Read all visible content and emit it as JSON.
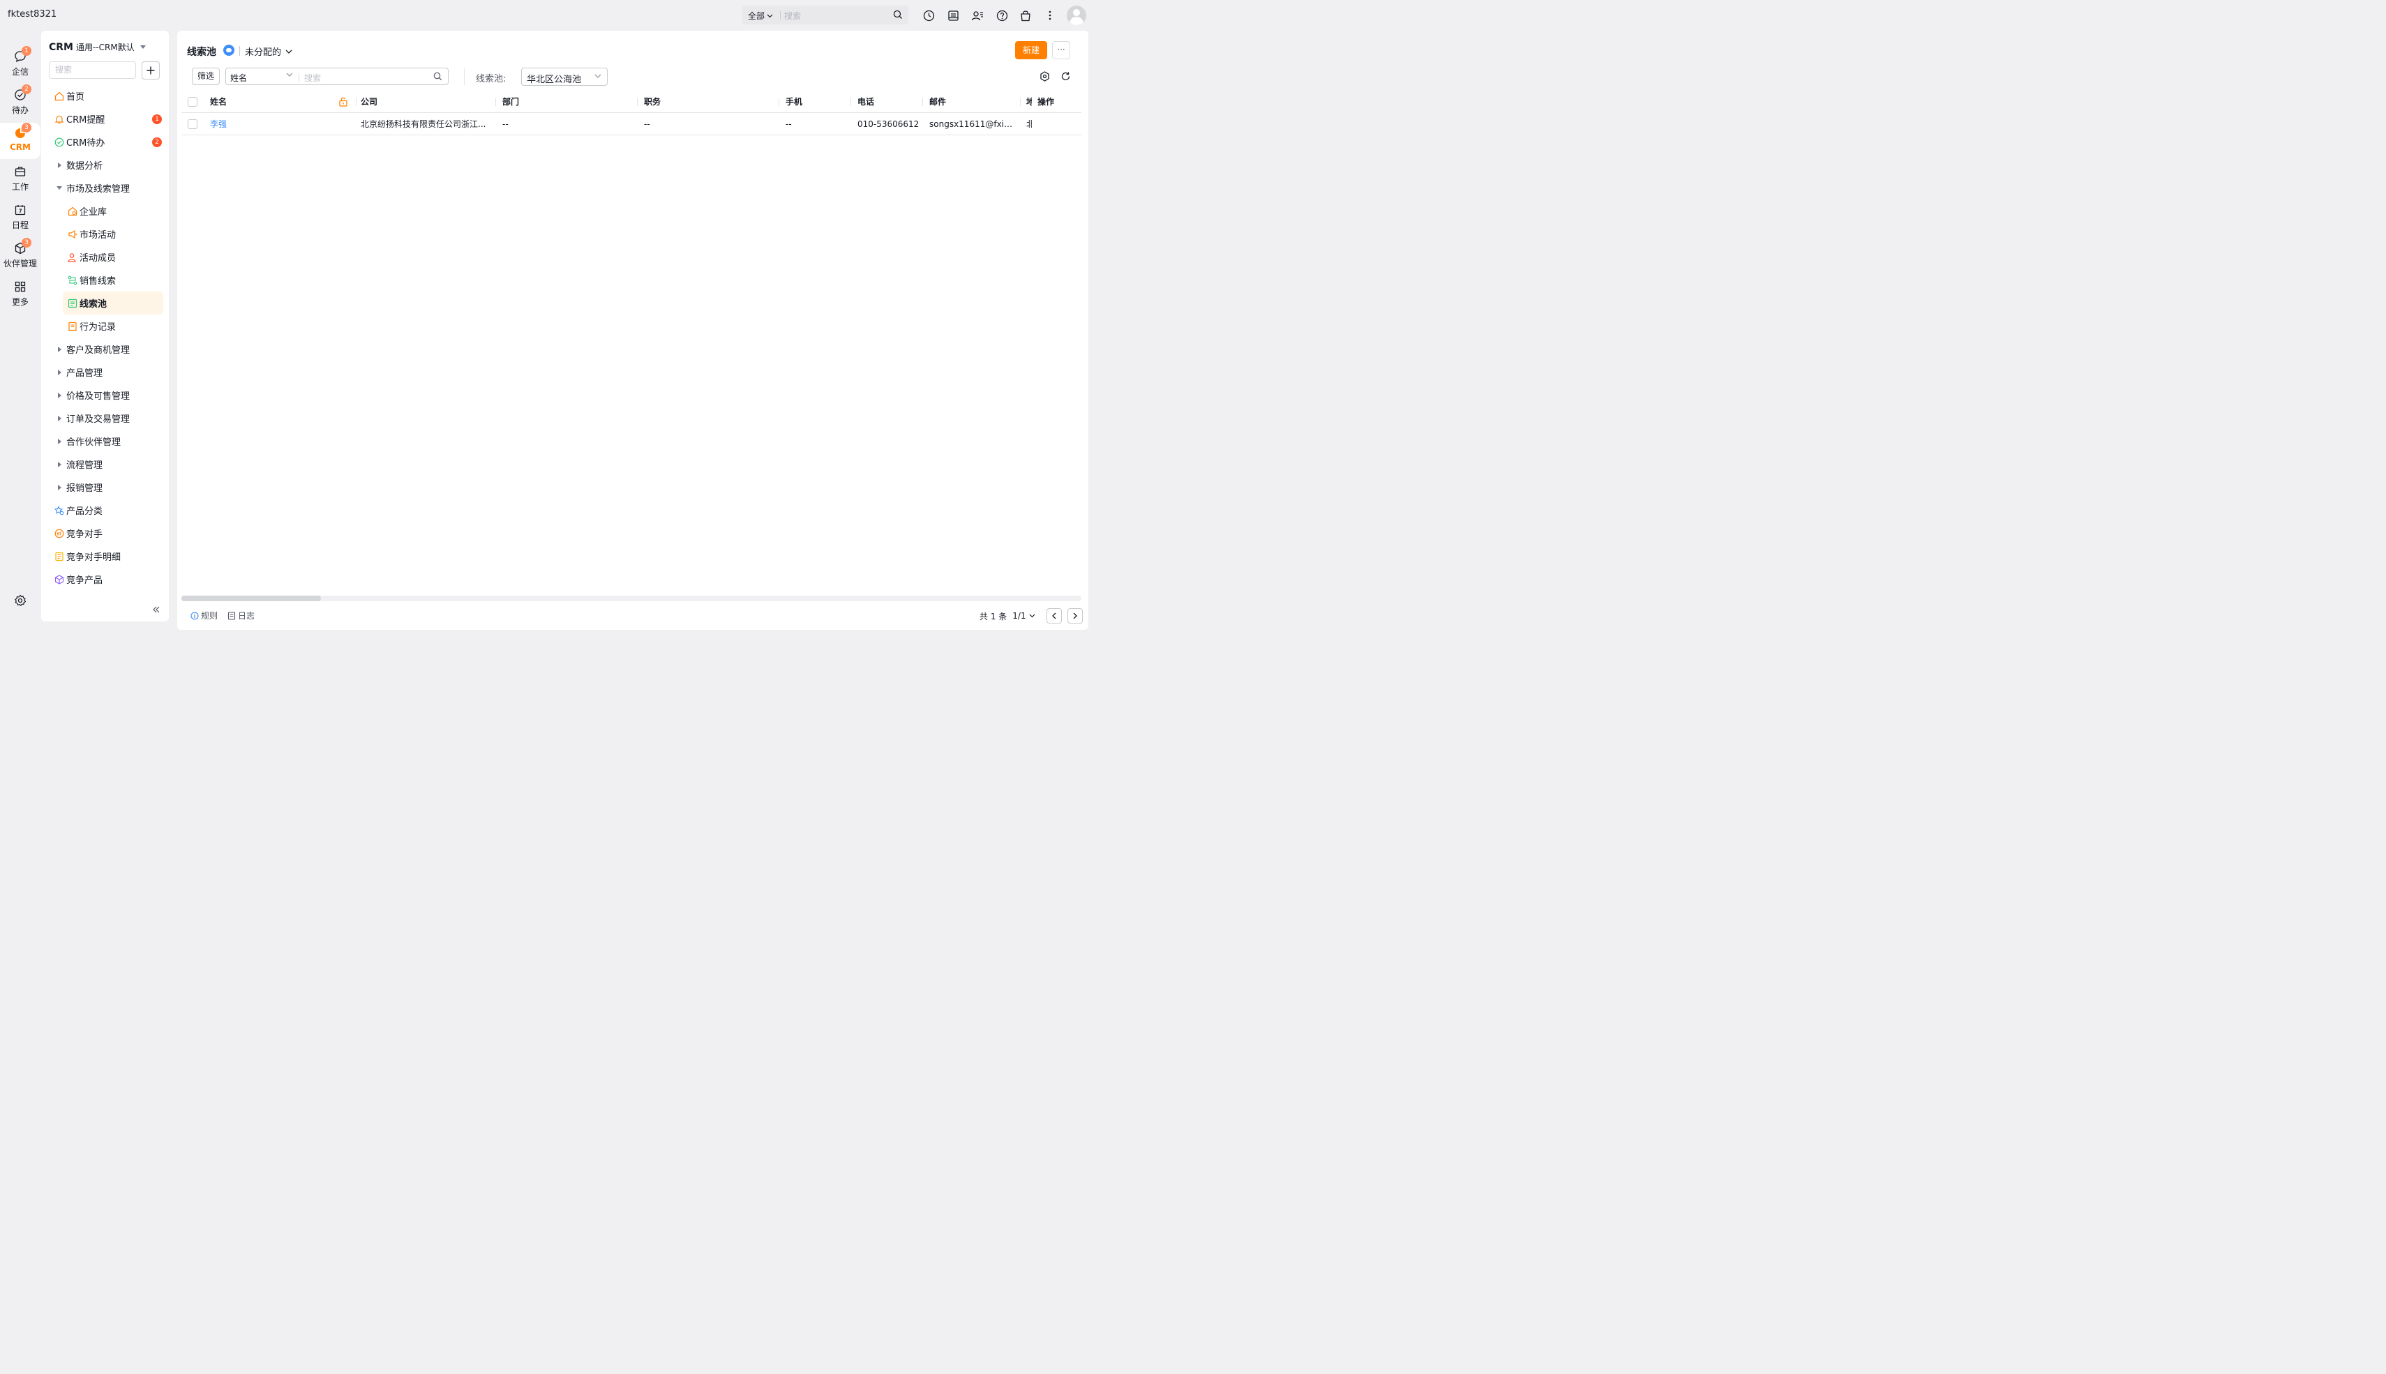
{
  "topbar": {
    "account": "fktest8321",
    "search_scope": "全部",
    "search_placeholder": "搜索",
    "icons": [
      "clock-icon",
      "inbox-icon",
      "contacts-icon",
      "help-icon",
      "bag-icon",
      "more-vertical-icon",
      "user-avatar"
    ]
  },
  "rail": {
    "items": [
      {
        "label": "企信",
        "badge": "1",
        "icon": "chat-bubble-icon"
      },
      {
        "label": "待办",
        "badge": "2",
        "icon": "todo-check-icon"
      },
      {
        "label": "CRM",
        "badge": "3",
        "icon": "crm-pie-icon",
        "active": true
      },
      {
        "label": "工作",
        "badge": "",
        "icon": "briefcase-icon"
      },
      {
        "label": "日程",
        "badge": "",
        "icon": "calendar-icon"
      },
      {
        "label": "伙伴管理",
        "badge": "3",
        "icon": "partner-cube-icon"
      },
      {
        "label": "更多",
        "badge": "",
        "icon": "apps-grid-icon"
      }
    ]
  },
  "menu": {
    "title_app": "CRM",
    "title_view": "通用--CRM默认",
    "search_placeholder": "搜索",
    "items": [
      {
        "label": "首页",
        "badge": ""
      },
      {
        "label": "CRM提醒",
        "badge": "1"
      },
      {
        "label": "CRM待办",
        "badge": "2"
      },
      {
        "label": "数据分析"
      },
      {
        "label": "市场及线索管理"
      },
      {
        "label": "企业库"
      },
      {
        "label": "市场活动"
      },
      {
        "label": "活动成员"
      },
      {
        "label": "销售线索"
      },
      {
        "label": "线索池"
      },
      {
        "label": "行为记录"
      },
      {
        "label": "客户及商机管理"
      },
      {
        "label": "产品管理"
      },
      {
        "label": "价格及可售管理"
      },
      {
        "label": "订单及交易管理"
      },
      {
        "label": "合作伙伴管理"
      },
      {
        "label": "流程管理"
      },
      {
        "label": "报销管理"
      },
      {
        "label": "产品分类"
      },
      {
        "label": "竞争对手"
      },
      {
        "label": "竞争对手明细"
      },
      {
        "label": "竞争产品"
      }
    ]
  },
  "main": {
    "title": "线索池",
    "scene": "未分配的",
    "new_button": "新建",
    "more_button": "···",
    "filter_button": "筛选",
    "search_field": "姓名",
    "search_placeholder": "搜索",
    "pool_label": "线索池:",
    "pool_value": "华北区公海池",
    "columns": [
      "姓名",
      "公司",
      "部门",
      "职务",
      "手机",
      "电话",
      "邮件",
      "地",
      "操作"
    ],
    "rows": [
      {
        "name": "李强",
        "company": "北京纷扬科技有限责任公司浙江...",
        "department": "--",
        "title": "--",
        "mobile": "--",
        "phone": "010-53606612",
        "email": "songsx11611@fxiao...",
        "addr": "北",
        "ops": ""
      }
    ],
    "footer": {
      "rules": "规则",
      "log": "日志",
      "total": "共 1 条",
      "page": "1/1"
    }
  },
  "colors": {
    "accent": "#ff8000",
    "link": "#3d8ef7",
    "badge": "#ff522a",
    "active_bg": "#fff5e6"
  }
}
